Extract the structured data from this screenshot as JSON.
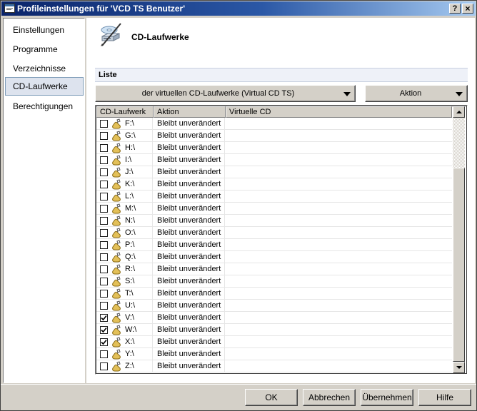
{
  "window": {
    "title": "Profileinstellungen für 'VCD TS Benutzer'",
    "help_glyph": "?",
    "close_glyph": "×"
  },
  "sidebar": {
    "items": [
      {
        "label": "Einstellungen",
        "selected": false
      },
      {
        "label": "Programme",
        "selected": false
      },
      {
        "label": "Verzeichnisse",
        "selected": false
      },
      {
        "label": "CD-Laufwerke",
        "selected": true
      },
      {
        "label": "Berechtigungen",
        "selected": false
      }
    ]
  },
  "page": {
    "title": "CD-Laufwerke",
    "icon": "cd-drives-icon"
  },
  "section": {
    "label": "Liste"
  },
  "toolbar": {
    "dropdown_label": "der virtuellen CD-Laufwerke (Virtual CD TS)",
    "action_label": "Aktion"
  },
  "table": {
    "columns": [
      "CD-Laufwerk",
      "Aktion",
      "Virtuelle CD"
    ],
    "rows": [
      {
        "drive": "F:\\",
        "action": "Bleibt unverändert",
        "cd": "",
        "checked": false
      },
      {
        "drive": "G:\\",
        "action": "Bleibt unverändert",
        "cd": "",
        "checked": false
      },
      {
        "drive": "H:\\",
        "action": "Bleibt unverändert",
        "cd": "",
        "checked": false
      },
      {
        "drive": "I:\\",
        "action": "Bleibt unverändert",
        "cd": "",
        "checked": false
      },
      {
        "drive": "J:\\",
        "action": "Bleibt unverändert",
        "cd": "",
        "checked": false
      },
      {
        "drive": "K:\\",
        "action": "Bleibt unverändert",
        "cd": "",
        "checked": false
      },
      {
        "drive": "L:\\",
        "action": "Bleibt unverändert",
        "cd": "",
        "checked": false
      },
      {
        "drive": "M:\\",
        "action": "Bleibt unverändert",
        "cd": "",
        "checked": false
      },
      {
        "drive": "N:\\",
        "action": "Bleibt unverändert",
        "cd": "",
        "checked": false
      },
      {
        "drive": "O:\\",
        "action": "Bleibt unverändert",
        "cd": "",
        "checked": false
      },
      {
        "drive": "P:\\",
        "action": "Bleibt unverändert",
        "cd": "",
        "checked": false
      },
      {
        "drive": "Q:\\",
        "action": "Bleibt unverändert",
        "cd": "",
        "checked": false
      },
      {
        "drive": "R:\\",
        "action": "Bleibt unverändert",
        "cd": "",
        "checked": false
      },
      {
        "drive": "S:\\",
        "action": "Bleibt unverändert",
        "cd": "",
        "checked": false
      },
      {
        "drive": "T:\\",
        "action": "Bleibt unverändert",
        "cd": "",
        "checked": false
      },
      {
        "drive": "U:\\",
        "action": "Bleibt unverändert",
        "cd": "",
        "checked": false
      },
      {
        "drive": "V:\\",
        "action": "Bleibt unverändert",
        "cd": "",
        "checked": true
      },
      {
        "drive": "W:\\",
        "action": "Bleibt unverändert",
        "cd": "",
        "checked": true
      },
      {
        "drive": "X:\\",
        "action": "Bleibt unverändert",
        "cd": "",
        "checked": true
      },
      {
        "drive": "Y:\\",
        "action": "Bleibt unverändert",
        "cd": "",
        "checked": false
      },
      {
        "drive": "Z:\\",
        "action": "Bleibt unverändert",
        "cd": "",
        "checked": false
      }
    ]
  },
  "footer": {
    "ok": "OK",
    "cancel": "Abbrechen",
    "apply": "Übernehmen",
    "help": "Hilfe"
  }
}
